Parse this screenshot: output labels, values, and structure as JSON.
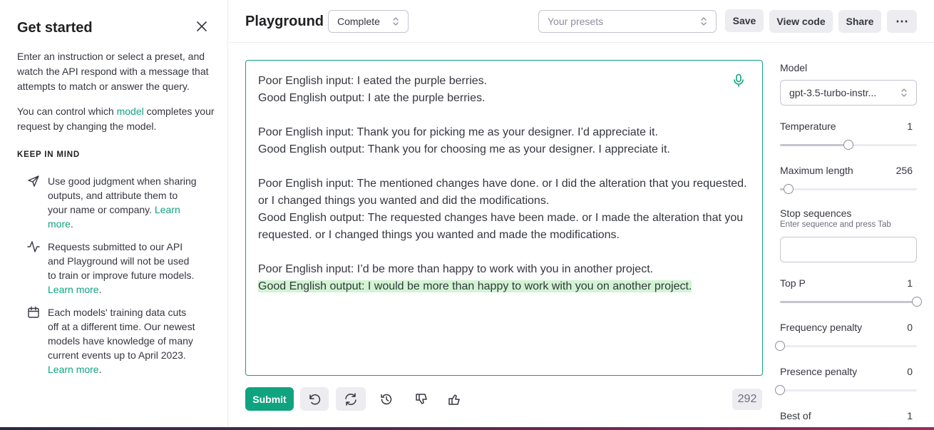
{
  "sidebar": {
    "title": "Get started",
    "intro": "Enter an instruction or select a preset, and watch the API respond with a message that attempts to match or answer the query.",
    "control_before": "You can control which ",
    "control_link": "model",
    "control_after": " completes your request by changing the model.",
    "keep_in_mind": "KEEP IN MIND",
    "tips": [
      {
        "icon": "send-icon",
        "text": "Use good judgment when sharing outputs, and attribute them to your name or company. ",
        "link": "Learn more",
        "suffix": "."
      },
      {
        "icon": "activity-icon",
        "text": "Requests submitted to our API and Playground will not be used to train or improve future models. ",
        "link": "Learn more",
        "suffix": "."
      },
      {
        "icon": "calendar-icon",
        "text": "Each models' training data cuts off at a different time. Our newest models have knowledge of many current events up to April 2023. ",
        "link": "Learn more",
        "suffix": "."
      }
    ]
  },
  "header": {
    "title": "Playground",
    "mode": "Complete",
    "presets_placeholder": "Your presets",
    "save": "Save",
    "view_code": "View code",
    "share": "Share",
    "more": "⋯"
  },
  "editor": {
    "lines": [
      "Poor English input: I eated the purple berries.",
      "Good English output: I ate the purple berries.",
      "",
      "Poor English input: Thank you for picking me as your designer. I’d appreciate it.",
      "Good English output: Thank you for choosing me as your designer. I appreciate it.",
      "",
      "Poor English input: The mentioned changes have done. or I did the alteration that you requested. or I changed things you wanted and did the modifications.",
      "Good English output: The requested changes have been made. or I made the alteration that you requested. or I changed things you wanted and made the modifications.",
      "",
      "Poor English input: I’d be more than happy to work with you in another project."
    ],
    "completion": "Good English output: I would be more than happy to work with you on another project."
  },
  "toolbar": {
    "submit": "Submit",
    "token_count": "292"
  },
  "settings": {
    "model_label": "Model",
    "model_value": "gpt-3.5-turbo-instr...",
    "temperature_label": "Temperature",
    "temperature_value": "1",
    "temperature_fraction": 0.5,
    "max_length_label": "Maximum length",
    "max_length_value": "256",
    "max_length_fraction": 0.06,
    "stop_label": "Stop sequences",
    "stop_hint": "Enter sequence and press Tab",
    "top_p_label": "Top P",
    "top_p_value": "1",
    "top_p_fraction": 1.0,
    "freq_label": "Frequency penalty",
    "freq_value": "0",
    "freq_fraction": 0.0,
    "presence_label": "Presence penalty",
    "presence_value": "0",
    "presence_fraction": 0.0,
    "best_of_label": "Best of",
    "best_of_value": "1"
  },
  "colors": {
    "accent": "#10a37f",
    "highlight": "#d2f4d3"
  }
}
